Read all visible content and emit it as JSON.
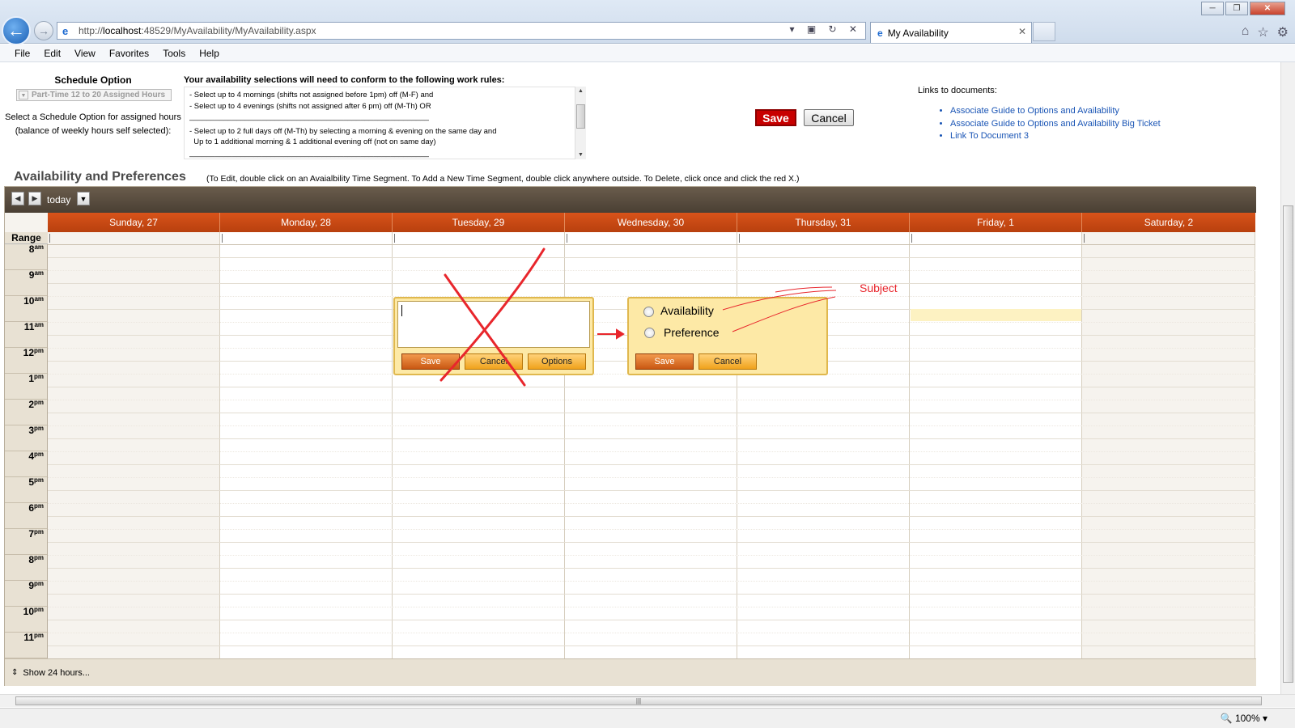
{
  "browser": {
    "url_prefix": "http://",
    "url_host": "localhost",
    "url_rest": ":48529/MyAvailability/MyAvailability.aspx",
    "tab_title": "My Availability",
    "menu": [
      "File",
      "Edit",
      "View",
      "Favorites",
      "Tools",
      "Help"
    ],
    "zoom": "100%"
  },
  "schedule": {
    "title": "Schedule Option",
    "selected": "Part-Time 12 to 20 Assigned Hours",
    "help": "Select a Schedule Option for assigned hours (balance of weekly hours self selected):"
  },
  "rules": {
    "title": "Your availability selections will need to conform to the following work rules:",
    "lines": [
      "- Select up to 4 mornings (shifts not assigned before 1pm) off (M-F) and",
      "- Select up to 4 evenings (shifts not assigned after 6 pm) off (M-Th) OR",
      "________________________________________________________",
      "- Select up to 2 full days off (M-Th) by selecting a morning & evening on the same day and",
      "  Up to 1 additional morning & 1 additional evening off (not on same day)",
      "________________________________________________________"
    ]
  },
  "actions": {
    "save": "Save",
    "cancel": "Cancel"
  },
  "links": {
    "title": "Links to documents:",
    "items": [
      "Associate Guide to Options and Availability",
      "Associate Guide to Options and Availability Big Ticket",
      "Link To Document 3"
    ]
  },
  "availability": {
    "title": "Availability and Preferences",
    "hint": "(To Edit, double click on an Avaialbility Time Segment. To Add a New Time Segment, double click anywhere outside. To Delete, click once and click the red X.)"
  },
  "calendar": {
    "today_label": "today",
    "range_label": "Range",
    "days": [
      "Sunday, 27",
      "Monday, 28",
      "Tuesday, 29",
      "Wednesday, 30",
      "Thursday, 31",
      "Friday, 1",
      "Saturday, 2"
    ],
    "times": [
      {
        "h": "8",
        "ap": "am"
      },
      {
        "h": "9",
        "ap": "am"
      },
      {
        "h": "10",
        "ap": "am"
      },
      {
        "h": "11",
        "ap": "am"
      },
      {
        "h": "12",
        "ap": "pm"
      },
      {
        "h": "1",
        "ap": "pm"
      },
      {
        "h": "2",
        "ap": "pm"
      },
      {
        "h": "3",
        "ap": "pm"
      },
      {
        "h": "4",
        "ap": "pm"
      },
      {
        "h": "5",
        "ap": "pm"
      },
      {
        "h": "6",
        "ap": "pm"
      },
      {
        "h": "7",
        "ap": "pm"
      },
      {
        "h": "8",
        "ap": "pm"
      },
      {
        "h": "9",
        "ap": "pm"
      },
      {
        "h": "10",
        "ap": "pm"
      },
      {
        "h": "11",
        "ap": "pm"
      }
    ],
    "footer": "Show 24 hours..."
  },
  "popup_old": {
    "save": "Save",
    "cancel": "Cancel",
    "options": "Options"
  },
  "popup_new": {
    "opt1": "Availability",
    "opt2": "Preference",
    "save": "Save",
    "cancel": "Cancel"
  },
  "annotation": {
    "subject": "Subject",
    "color": "#e8262c"
  }
}
